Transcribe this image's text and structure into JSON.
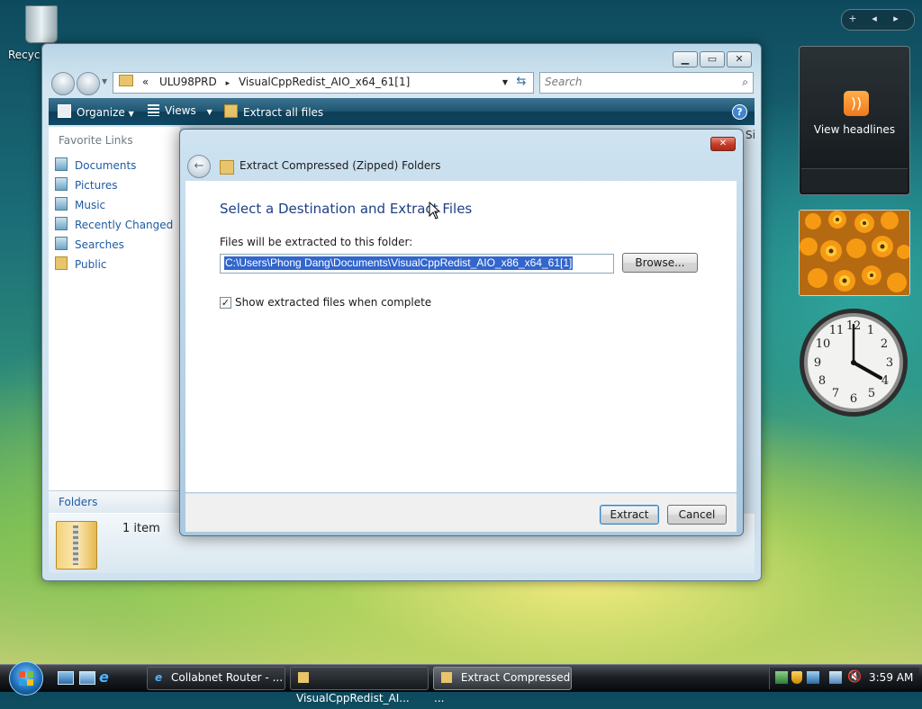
{
  "desktop": {
    "recycle_label": "Recyc"
  },
  "explorer": {
    "address_chevron": "«",
    "address_crumb1": "ULU98PRD",
    "address_sep": "▸",
    "address_crumb2": "VisualCppRedist_AIO_x64_61[1]",
    "search_placeholder": "Search",
    "toolbar": {
      "organize": "Organize",
      "views": "Views",
      "extract_all": "Extract all files"
    },
    "favorite_links_header": "Favorite Links",
    "links": [
      "Documents",
      "Pictures",
      "Music",
      "Recently Changed",
      "Searches",
      "Public"
    ],
    "folders_label": "Folders",
    "column_header": "Si",
    "item_count": "1 item"
  },
  "dialog": {
    "title": "Extract Compressed (Zipped) Folders",
    "heading": "Select a Destination and Extract Files",
    "dest_label": "Files will be extracted to this folder:",
    "dest_path": "C:\\Users\\Phong Dang\\Documents\\VisualCppRedist_AIO_x86_x64_61[1]",
    "browse_label": "Browse...",
    "show_files_label": "Show extracted files when complete",
    "show_files_checked": true,
    "extract_label": "Extract",
    "cancel_label": "Cancel"
  },
  "gadgets": {
    "feed_text": "View headlines",
    "clock_numbers": [
      "12",
      "1",
      "2",
      "3",
      "4",
      "5",
      "6",
      "7",
      "8",
      "9",
      "10",
      "11"
    ]
  },
  "taskbar": {
    "tasks": [
      "Collabnet Router - ...",
      "VisualCppRedist_AI...",
      "Extract Compressed ..."
    ],
    "time": "3:59 AM"
  }
}
